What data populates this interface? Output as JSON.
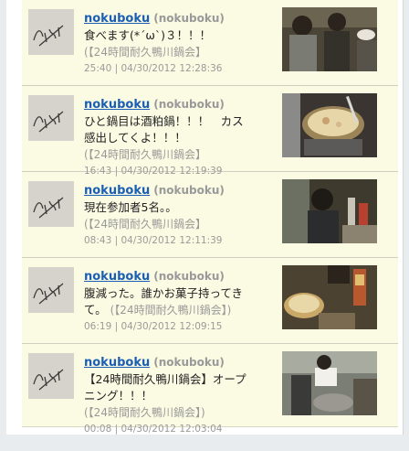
{
  "feed": {
    "tweets": [
      {
        "username": "nokuboku",
        "handle": "(nokuboku)",
        "lines": [
          "食べます(*´ω`)３！！！"
        ],
        "tag": "(【24時間耐久鴨川鍋会】",
        "meta": "25:40 | 04/30/2012 12:28:36",
        "photo_icon": "photo-people-eating"
      },
      {
        "username": "nokuboku",
        "handle": "(nokuboku)",
        "lines": [
          "ひと鍋目は酒粕鍋！！！　カス",
          "感出してくよ！！！"
        ],
        "tag": "(【24時間耐久鴨川鍋会】",
        "meta": "16:43 | 04/30/2012 12:19:39",
        "photo_icon": "photo-hotpot"
      },
      {
        "username": "nokuboku",
        "handle": "(nokuboku)",
        "lines": [
          "現在参加者5名。。"
        ],
        "tag": "(【24時間耐久鴨川鍋会】",
        "meta": "08:43 | 04/30/2012 12:11:39",
        "photo_icon": "photo-participant"
      },
      {
        "username": "nokuboku",
        "handle": "(nokuboku)",
        "lines": [
          "腹減った。誰かお菓子持ってき",
          "て。"
        ],
        "tag": "(【24時間耐久鴨川鍋会】)",
        "meta": "06:19 | 04/30/2012 12:09:15",
        "photo_icon": "photo-snacks"
      },
      {
        "username": "nokuboku",
        "handle": "(nokuboku)",
        "lines": [
          "【24時間耐久鴨川鍋会】オープ",
          "ニング！！！"
        ],
        "tag": "(【24時間耐久鴨川鍋会】)",
        "meta": "00:08 | 04/30/2012 12:03:04",
        "photo_icon": "photo-opening"
      }
    ]
  }
}
